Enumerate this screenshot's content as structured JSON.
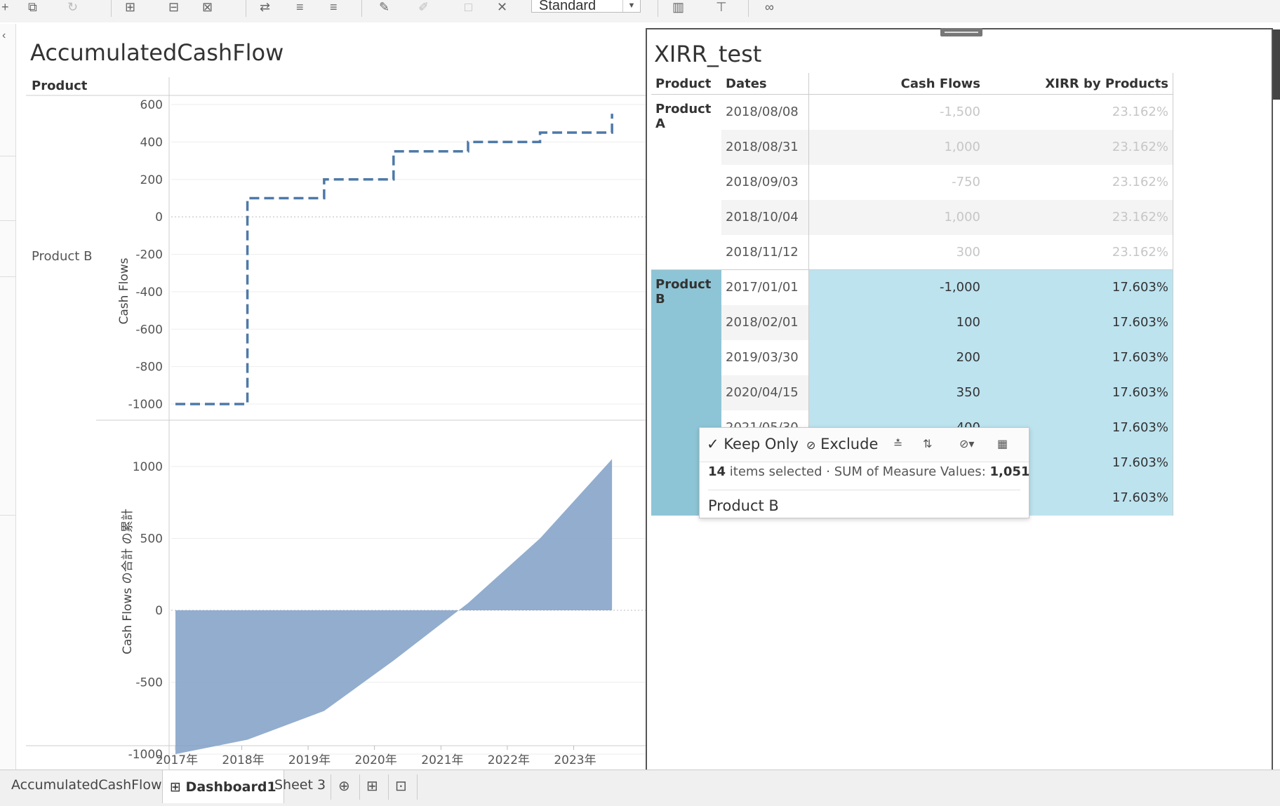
{
  "toolbar": {
    "style_select": "Standard",
    "icons": [
      "add-icon",
      "copy-icon",
      "undo-icon",
      "new-sheet-icon",
      "duplicate-icon",
      "clear-sheet-icon",
      "swap-icon",
      "sort-asc-icon",
      "sort-desc-icon",
      "highlight-icon",
      "format-icon",
      "label-icon",
      "pin-icon",
      "show-me-icon",
      "presentation-icon",
      "share-icon"
    ]
  },
  "left_sheet": {
    "title": "AccumulatedCashFlow",
    "product_header": "Product",
    "row_label": "Product B",
    "top_chart_ylabel": "Cash Flows",
    "bottom_chart_ylabel": "Cash Flows の合計 の累計"
  },
  "chart_data": [
    {
      "type": "line",
      "line_style": "dashed-step",
      "color": "#4e79a7",
      "ylabel": "Cash Flows",
      "ylim": [
        -1000,
        600
      ],
      "yticks": [
        600,
        400,
        200,
        0,
        -200,
        -400,
        -600,
        -800,
        -1000
      ],
      "x": [
        "2017-01-01",
        "2018-02-01",
        "2019-03-30",
        "2020-04-15",
        "2021-05-30",
        "2022-06-30",
        "2023-07-31"
      ],
      "y": [
        -1000,
        100,
        200,
        350,
        400,
        450,
        551
      ]
    },
    {
      "type": "area",
      "color": "#7f9fc5",
      "ylabel": "Cash Flows の合計 の累計",
      "ylim": [
        -1100,
        1100
      ],
      "yticks": [
        1000,
        500,
        0,
        -500,
        -1000
      ],
      "x": [
        "2017-01-01",
        "2018-02-01",
        "2019-03-30",
        "2020-04-15",
        "2021-05-30",
        "2022-06-30",
        "2023-07-31"
      ],
      "y": [
        -1000,
        -900,
        -700,
        -350,
        50,
        500,
        1051
      ],
      "xticks": [
        "2017年",
        "2018年",
        "2019年",
        "2020年",
        "2021年",
        "2022年",
        "2023年"
      ]
    }
  ],
  "right_sheet": {
    "title": "XIRR_test",
    "headers": {
      "product": "Product",
      "dates": "Dates",
      "cash_flows": "Cash Flows",
      "xirr": "XIRR by Products"
    },
    "product_a": {
      "name": "Product A",
      "rows": [
        {
          "date": "2018/08/08",
          "cf": "-1,500",
          "xirr": "23.162%"
        },
        {
          "date": "2018/08/31",
          "cf": "1,000",
          "xirr": "23.162%"
        },
        {
          "date": "2018/09/03",
          "cf": "-750",
          "xirr": "23.162%"
        },
        {
          "date": "2018/10/04",
          "cf": "1,000",
          "xirr": "23.162%"
        },
        {
          "date": "2018/11/12",
          "cf": "300",
          "xirr": "23.162%"
        }
      ]
    },
    "product_b": {
      "name": "Product B",
      "rows": [
        {
          "date": "2017/01/01",
          "cf": "-1,000",
          "xirr": "17.603%"
        },
        {
          "date": "2018/02/01",
          "cf": "100",
          "xirr": "17.603%"
        },
        {
          "date": "2019/03/30",
          "cf": "200",
          "xirr": "17.603%"
        },
        {
          "date": "2020/04/15",
          "cf": "350",
          "xirr": "17.603%"
        },
        {
          "date": "2021/05/30",
          "cf": "400",
          "xirr": "17.603%"
        },
        {
          "date": "",
          "cf": "",
          "xirr": "17.603%"
        },
        {
          "date": "",
          "cf": "",
          "xirr": "17.603%"
        }
      ]
    }
  },
  "tooltip": {
    "keep_only": "Keep Only",
    "exclude": "Exclude",
    "items_count": "14",
    "items_text": "items selected",
    "sum_label": "SUM of Measure Values:",
    "sum_value": "1,051",
    "product": "Product B"
  },
  "tabs": {
    "sheet1": "AccumulatedCashFlow",
    "dashboard": "Dashboard1",
    "sheet3": "Sheet 3"
  }
}
